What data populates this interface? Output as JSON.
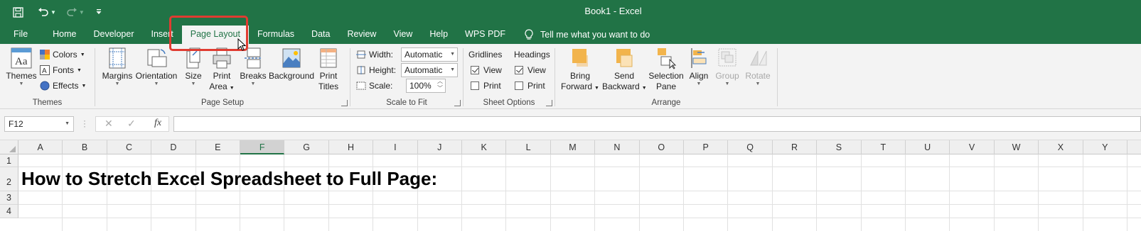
{
  "window": {
    "title": "Book1  -  Excel"
  },
  "tabs": [
    {
      "label": "File"
    },
    {
      "label": "Home"
    },
    {
      "label": "Developer"
    },
    {
      "label": "Insert"
    },
    {
      "label": "Page Layout",
      "active": true
    },
    {
      "label": "Formulas"
    },
    {
      "label": "Data"
    },
    {
      "label": "Review"
    },
    {
      "label": "View"
    },
    {
      "label": "Help"
    },
    {
      "label": "WPS PDF"
    }
  ],
  "tell_me": {
    "label": "Tell me what you want to do"
  },
  "ribbon": {
    "themes": {
      "group_label": "Themes",
      "themes_label": "Themes",
      "colors_label": "Colors",
      "fonts_label": "Fonts",
      "effects_label": "Effects"
    },
    "page_setup": {
      "group_label": "Page Setup",
      "margins_label": "Margins",
      "orientation_label": "Orientation",
      "size_label": "Size",
      "print_area_line1": "Print",
      "print_area_line2": "Area",
      "breaks_label": "Breaks",
      "background_label": "Background",
      "print_titles_line1": "Print",
      "print_titles_line2": "Titles"
    },
    "scale_to_fit": {
      "group_label": "Scale to Fit",
      "width_label": "Width:",
      "width_value": "Automatic",
      "height_label": "Height:",
      "height_value": "Automatic",
      "scale_label": "Scale:",
      "scale_value": "100%"
    },
    "sheet_options": {
      "group_label": "Sheet Options",
      "gridlines_label": "Gridlines",
      "headings_label": "Headings",
      "view_label": "View",
      "print_label": "Print",
      "gridlines_view": true,
      "gridlines_print": false,
      "headings_view": true,
      "headings_print": false
    },
    "arrange": {
      "group_label": "Arrange",
      "bring_forward_line1": "Bring",
      "bring_forward_line2": "Forward",
      "send_backward_line1": "Send",
      "send_backward_line2": "Backward",
      "selection_pane_line1": "Selection",
      "selection_pane_line2": "Pane",
      "align_label": "Align",
      "group_btn_label": "Group",
      "rotate_label": "Rotate"
    }
  },
  "formula_bar": {
    "name_box": "F12",
    "fx_label": "fx",
    "formula": ""
  },
  "grid": {
    "columns": [
      "A",
      "B",
      "C",
      "D",
      "E",
      "F",
      "G",
      "H",
      "I",
      "J",
      "K",
      "L",
      "M",
      "N",
      "O",
      "P",
      "Q",
      "R",
      "S",
      "T",
      "U",
      "V",
      "W",
      "X",
      "Y"
    ],
    "selected_column": "F",
    "rows": [
      "1",
      "2",
      "3",
      "4"
    ],
    "cell_A2": "How to Stretch Excel Spreadsheet to Full Page:"
  },
  "colors": {
    "excel_green": "#217346",
    "highlight_red": "#e03c31"
  }
}
